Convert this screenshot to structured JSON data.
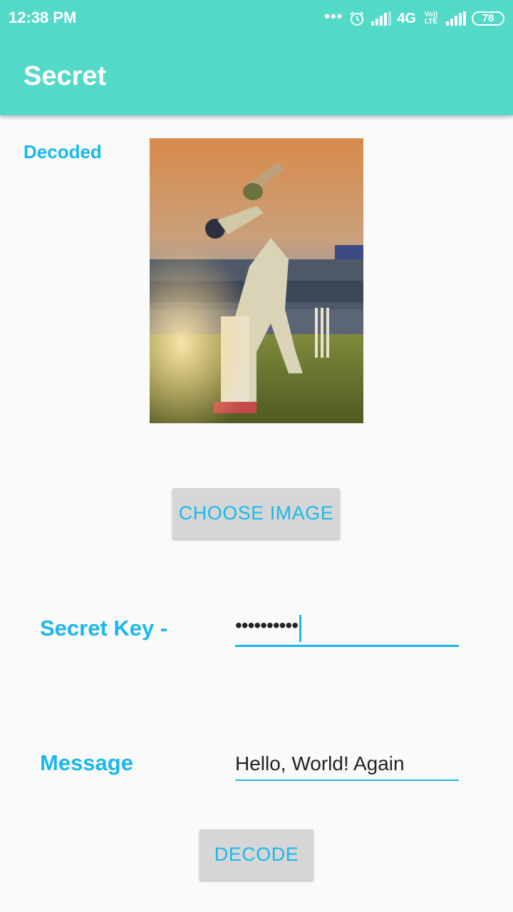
{
  "status_bar": {
    "time": "12:38 PM",
    "dots": "•••",
    "network": "4G",
    "volte": "Vo)) LTE",
    "battery": "78"
  },
  "app_bar": {
    "title": "Secret"
  },
  "decoded_label": "Decoded",
  "image": {
    "description": "cricket batsman in stadium"
  },
  "choose_image_button": "CHOOSE IMAGE",
  "secret_key": {
    "label": "Secret Key -",
    "value": "••••••••••"
  },
  "message": {
    "label": "Message",
    "value": "Hello, World!  Again"
  },
  "decode_button": "DECODE",
  "colors": {
    "accent": "#1ab8ea",
    "primary": "#52d9c7"
  }
}
